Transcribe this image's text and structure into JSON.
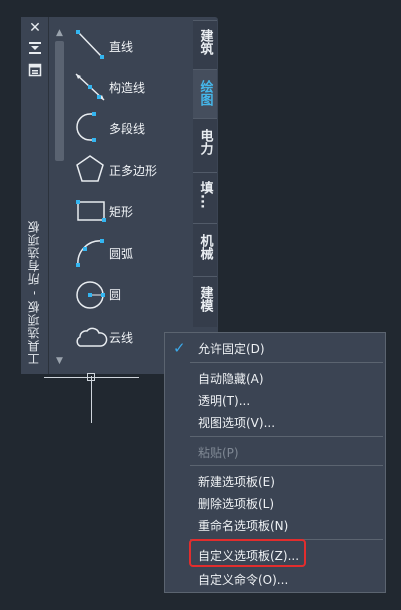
{
  "palette": {
    "title": "工具选项板 - 所有选项板",
    "tools": [
      {
        "label": "直线",
        "icon": "line-icon"
      },
      {
        "label": "构造线",
        "icon": "construction-line-icon"
      },
      {
        "label": "多段线",
        "icon": "polyline-icon"
      },
      {
        "label": "正多边形",
        "icon": "polygon-icon"
      },
      {
        "label": "矩形",
        "icon": "rectangle-icon"
      },
      {
        "label": "圆弧",
        "icon": "arc-icon"
      },
      {
        "label": "圆",
        "icon": "circle-icon"
      },
      {
        "label": "云线",
        "icon": "revcloud-icon"
      }
    ],
    "tabs": [
      {
        "label": "建筑",
        "active": false
      },
      {
        "label": "绘图",
        "active": true
      },
      {
        "label": "电力",
        "active": false
      },
      {
        "label": "填...",
        "active": false
      },
      {
        "label": "机械",
        "active": false
      },
      {
        "label": "建模",
        "active": false
      }
    ]
  },
  "context_menu": {
    "items": [
      {
        "label": "允许固定(D)",
        "checked": true,
        "disabled": false
      },
      {
        "label": "自动隐藏(A)",
        "disabled": false
      },
      {
        "label": "透明(T)...",
        "disabled": false
      },
      {
        "label": "视图选项(V)...",
        "disabled": false
      },
      {
        "label": "粘贴(P)",
        "disabled": true
      },
      {
        "label": "新建选项板(E)",
        "disabled": false
      },
      {
        "label": "删除选项板(L)",
        "disabled": false
      },
      {
        "label": "重命名选项板(N)",
        "disabled": false
      },
      {
        "label": "自定义选项板(Z)...",
        "disabled": false,
        "highlighted": true
      },
      {
        "label": "自定义命令(O)...",
        "disabled": false
      }
    ]
  },
  "colors": {
    "accent": "#3ba8e8",
    "highlight_box": "#e22d2d",
    "grip": "#33b5f0"
  }
}
